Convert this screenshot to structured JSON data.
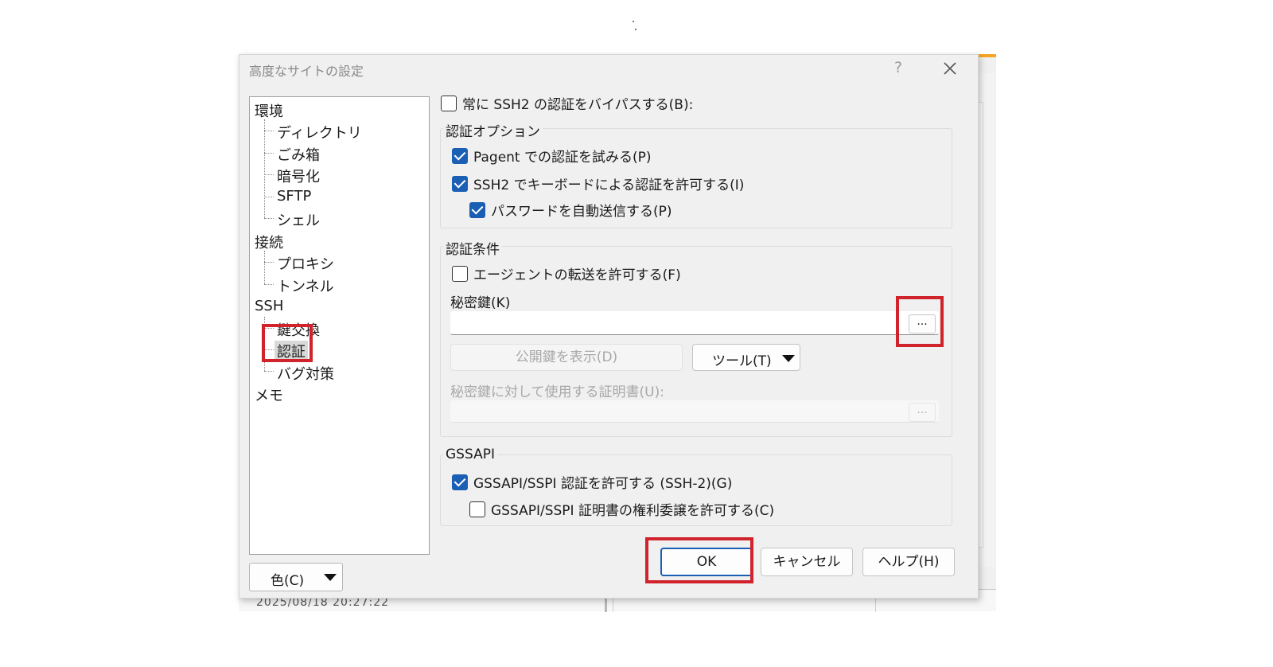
{
  "dialog": {
    "title": "高度なサイトの設定",
    "help_glyph": "?",
    "close_glyph": "×"
  },
  "background": {
    "datetime_fragment": "2025/08/18 20:27:22"
  },
  "tree": {
    "items": [
      {
        "label": "環境"
      },
      {
        "label": "ディレクトリ"
      },
      {
        "label": "ごみ箱"
      },
      {
        "label": "暗号化"
      },
      {
        "label": "SFTP"
      },
      {
        "label": "シェル"
      },
      {
        "label": "接続"
      },
      {
        "label": "プロキシ"
      },
      {
        "label": "トンネル"
      },
      {
        "label": "SSH"
      },
      {
        "label": "鍵交換"
      },
      {
        "label": "認証",
        "selected": true
      },
      {
        "label": "バグ対策"
      },
      {
        "label": "メモ"
      }
    ]
  },
  "color_combo": {
    "label": "色(C)"
  },
  "bypass": {
    "label": "常に SSH2 の認証をバイパスする(B):",
    "checked": false
  },
  "auth_options": {
    "title": "認証オプション",
    "pageant": {
      "label": "Pagent での認証を試みる(P)",
      "checked": true
    },
    "keyboard": {
      "label": "SSH2 でキーボードによる認証を許可する(I)",
      "checked": true
    },
    "auto_password": {
      "label": "パスワードを自動送信する(P)",
      "checked": true
    }
  },
  "auth_conditions": {
    "title": "認証条件",
    "agent_forward": {
      "label": "エージェントの転送を許可する(F)",
      "checked": false
    },
    "private_key_label": "秘密鍵(K)",
    "private_key_value": "",
    "browse_label": "...",
    "show_public_key": "公開鍵を表示(D)",
    "tools_label": "ツール(T)",
    "cert_label": "秘密鍵に対して使用する証明書(U):",
    "cert_value": "",
    "cert_browse": "..."
  },
  "gssapi": {
    "title": "GSSAPI",
    "allow": {
      "label": "GSSAPI/SSPI 認証を許可する (SSH-2)(G)",
      "checked": true
    },
    "delegate": {
      "label": "GSSAPI/SSPI 証明書の権利委譲を許可する(C)",
      "checked": false
    }
  },
  "buttons": {
    "ok": "OK",
    "cancel": "キャンセル",
    "help": "ヘルプ(H)"
  },
  "colors": {
    "accent": "#1a5fb4",
    "highlight": "#d0232c"
  }
}
